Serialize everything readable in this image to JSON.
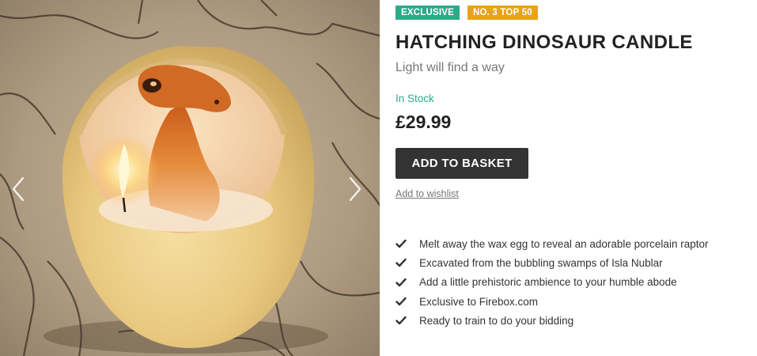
{
  "gallery": {
    "prev_icon": "chevron-left-icon",
    "next_icon": "chevron-right-icon"
  },
  "product": {
    "badges": [
      {
        "label": "EXCLUSIVE",
        "color": "#2bab8a"
      },
      {
        "label": "NO. 3 TOP 50",
        "color": "#e8a317"
      }
    ],
    "title": "HATCHING DINOSAUR CANDLE",
    "subtitle": "Light will find a way",
    "stock_status": "In Stock",
    "price": "£29.99",
    "basket_label": "ADD TO BASKET",
    "wishlist_label": "Add to wishlist",
    "features": [
      "Melt away the wax egg to reveal an adorable porcelain raptor",
      "Excavated from the bubbling swamps of Isla Nublar",
      "Add a little prehistoric ambience to your humble abode",
      "Exclusive to Firebox.com",
      "Ready to train to do your bidding"
    ]
  },
  "colors": {
    "accent_green": "#2bab8a",
    "accent_amber": "#e8a317",
    "button_dark": "#333333"
  }
}
